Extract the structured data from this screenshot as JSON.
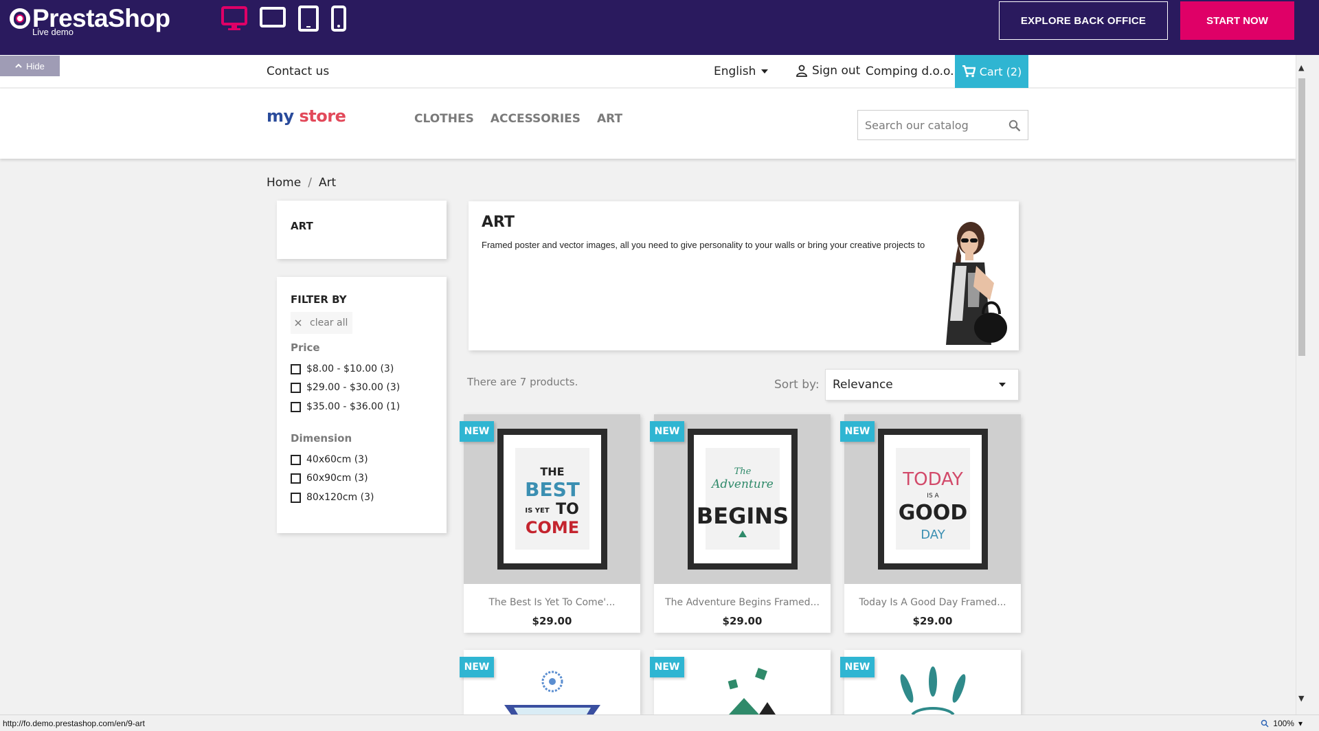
{
  "demo_bar": {
    "logo_text": "PrestaShop",
    "logo_subtitle": "Live demo",
    "devices": [
      "desktop-icon",
      "laptop-icon",
      "tablet-icon",
      "mobile-icon"
    ],
    "explore_label": "EXPLORE BACK OFFICE",
    "start_label": "START NOW",
    "accent": "#df0067",
    "bg": "#2a1a5e"
  },
  "hide_label": "Hide",
  "top_nav": {
    "contact": "Contact us",
    "language": "English",
    "sign_out": "Sign out",
    "company": "Comping d.o.o.",
    "cart": "Cart (2)"
  },
  "header": {
    "logo_my": "my",
    "logo_store": "store",
    "menu": [
      "CLOTHES",
      "ACCESSORIES",
      "ART"
    ],
    "search_placeholder": "Search our catalog"
  },
  "breadcrumb": [
    "Home",
    "/",
    "Art"
  ],
  "sidebar": {
    "category_title": "ART",
    "filter_title": "FILTER BY",
    "clear_all": "clear all",
    "price": {
      "title": "Price",
      "options": [
        "$8.00 - $10.00 (3)",
        "$29.00 - $30.00 (3)",
        "$35.00 - $36.00 (1)"
      ]
    },
    "dimension": {
      "title": "Dimension",
      "options": [
        "40x60cm (3)",
        "60x90cm (3)",
        "80x120cm (3)"
      ]
    }
  },
  "category": {
    "title": "ART",
    "description": "Framed poster and vector images, all you need to give personality to your walls or bring your creative projects to life."
  },
  "listing": {
    "total": "There are 7 products.",
    "sort_label": "Sort by:",
    "sort_value": "Relevance"
  },
  "products": [
    {
      "flag": "NEW",
      "name": "The Best Is Yet To Come'...",
      "price": "$29.00",
      "poster": [
        "THE",
        "BEST",
        "IS YET",
        "TO",
        "COME"
      ]
    },
    {
      "flag": "NEW",
      "name": "The Adventure Begins Framed...",
      "price": "$29.00",
      "poster": [
        "The",
        "Adventure",
        "BEGINS"
      ]
    },
    {
      "flag": "NEW",
      "name": "Today Is A Good Day Framed...",
      "price": "$29.00",
      "poster": [
        "TODAY",
        "IS A",
        "GOOD",
        "DAY"
      ]
    },
    {
      "flag": "NEW"
    },
    {
      "flag": "NEW"
    },
    {
      "flag": "NEW"
    }
  ],
  "status": {
    "url": "http://fo.demo.prestashop.com/en/9-art",
    "zoom": "100%"
  }
}
